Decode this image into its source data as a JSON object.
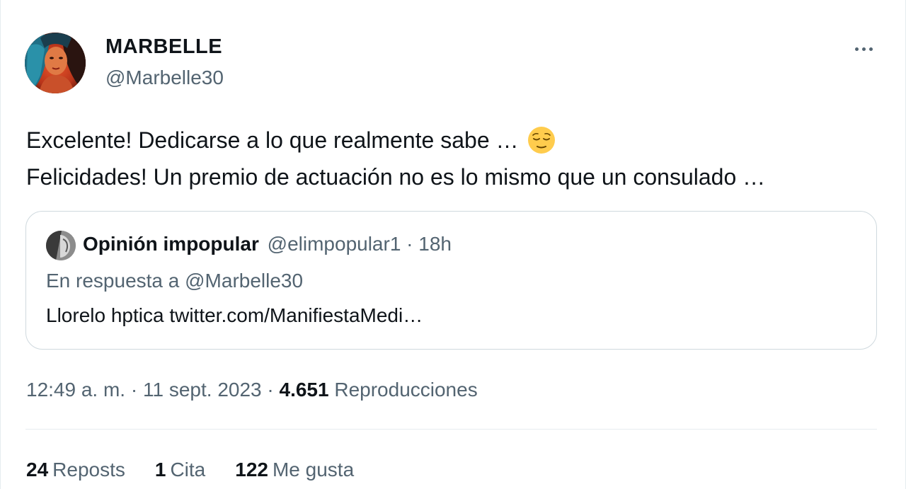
{
  "author": {
    "name": "MARBELLE",
    "handle": "@Marbelle30"
  },
  "tweet": {
    "line1": "Excelente! Dedicarse a lo que realmente sabe …",
    "line1_emoji": "relieved-face-emoji",
    "line2": "Felicidades! Un premio de actuación no es lo mismo que un consulado …"
  },
  "quote": {
    "name": "Opinión impopular",
    "handle_time": "@elimpopular1 · 18h",
    "reply_to": "En respuesta a @Marbelle30",
    "text": "Llorelo hptica twitter.com/ManifiestaMedi…"
  },
  "meta": {
    "time": "12:49 a. m.",
    "sep1": " · ",
    "date": "11 sept. 2023",
    "sep2": " · ",
    "views_count": "4.651",
    "views_label": "Reproducciones"
  },
  "stats": {
    "reposts_count": "24",
    "reposts_label": "Reposts",
    "quotes_count": "1",
    "quotes_label": "Cita",
    "likes_count": "122",
    "likes_label": "Me gusta"
  },
  "colors": {
    "primary_text": "#0f1419",
    "secondary_text": "#536471",
    "border": "#cfd9de",
    "emoji_face": "#ffcc4d"
  },
  "icons": {
    "more": "more-horizontal-icon"
  }
}
